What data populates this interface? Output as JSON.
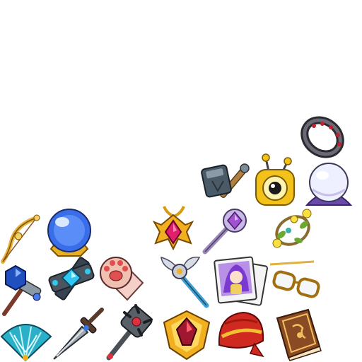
{
  "sprite_sheet": {
    "background": "#ffffff",
    "items": [
      {
        "id": "dark-ring",
        "icon": "ring-icon",
        "colors": {
          "band": "#3a3a44",
          "gems": "#c02030"
        }
      },
      {
        "id": "iron-hammer",
        "icon": "hammer-icon",
        "colors": {
          "head": "#4a5a66",
          "handle": "#b08040"
        }
      },
      {
        "id": "golden-eye-orb",
        "icon": "eye-orb-icon",
        "colors": {
          "gold": "#f2c21a",
          "pupil": "#1a1a1a"
        }
      },
      {
        "id": "pearl-orb-on-stand",
        "icon": "crystal-ball-icon",
        "colors": {
          "orb": "#eef0ff",
          "stand": "#6a4aa8"
        }
      },
      {
        "id": "golden-bow",
        "icon": "bow-icon",
        "colors": {
          "gold": "#e8b23a",
          "string": "#8a5a2a"
        }
      },
      {
        "id": "blue-crystal-ball",
        "icon": "crystal-ball-icon",
        "colors": {
          "orb": "#3a6ee8",
          "base": "#e8b020"
        }
      },
      {
        "id": "ruby-sun-amulet",
        "icon": "amulet-icon",
        "colors": {
          "gold": "#f0b020",
          "gem": "#e0206a"
        }
      },
      {
        "id": "amethyst-wand",
        "icon": "wand-icon",
        "colors": {
          "gem": "#a050d0",
          "shaft": "#9a8ab8"
        }
      },
      {
        "id": "flower-vine-wreath",
        "icon": "wreath-icon",
        "colors": {
          "vine": "#8a6a30",
          "leaf": "#6aa830",
          "flower": "#f8e040"
        }
      },
      {
        "id": "sapphire-scepter",
        "icon": "scepter-icon",
        "colors": {
          "gem": "#2050c0",
          "shaft": "#7a3a2a"
        }
      },
      {
        "id": "steel-cross-guard",
        "icon": "guard-icon",
        "colors": {
          "steel": "#4a5560",
          "gem": "#30c8f0"
        }
      },
      {
        "id": "cat-paw-glove",
        "icon": "paw-icon",
        "colors": {
          "fur": "#f0c0b0",
          "pad": "#e05050"
        }
      },
      {
        "id": "winged-staff",
        "icon": "staff-icon",
        "colors": {
          "shaft": "#40a0d0",
          "wing": "#d8dce8"
        }
      },
      {
        "id": "portrait-photos",
        "icon": "photo-icon",
        "colors": {
          "frame": "#f4f4f4",
          "hair": "#7a3ad0"
        }
      },
      {
        "id": "gold-glasses",
        "icon": "glasses-icon",
        "colors": {
          "frame": "#e0b040",
          "lens": "#f4f6fa"
        }
      },
      {
        "id": "teal-feather-fan",
        "icon": "fan-icon",
        "colors": {
          "fan": "#2ab0c8",
          "light": "#c8f4f8"
        }
      },
      {
        "id": "steel-short-sword",
        "icon": "sword-icon",
        "colors": {
          "blade": "#a0a8b0",
          "hilt": "#5a3a2a"
        }
      },
      {
        "id": "spiked-mace",
        "icon": "mace-icon",
        "colors": {
          "head": "#5a6068",
          "accent": "#e03040"
        }
      },
      {
        "id": "gold-garnet-crest",
        "icon": "crest-icon",
        "colors": {
          "gold": "#f0b020",
          "gem": "#a01830"
        }
      },
      {
        "id": "red-turban-hat",
        "icon": "hat-icon",
        "colors": {
          "cloth": "#d02a20",
          "gold": "#f0c030"
        }
      },
      {
        "id": "leather-spellbook",
        "icon": "book-icon",
        "colors": {
          "cover": "#8a4a24",
          "trim": "#f0c060"
        }
      }
    ]
  }
}
